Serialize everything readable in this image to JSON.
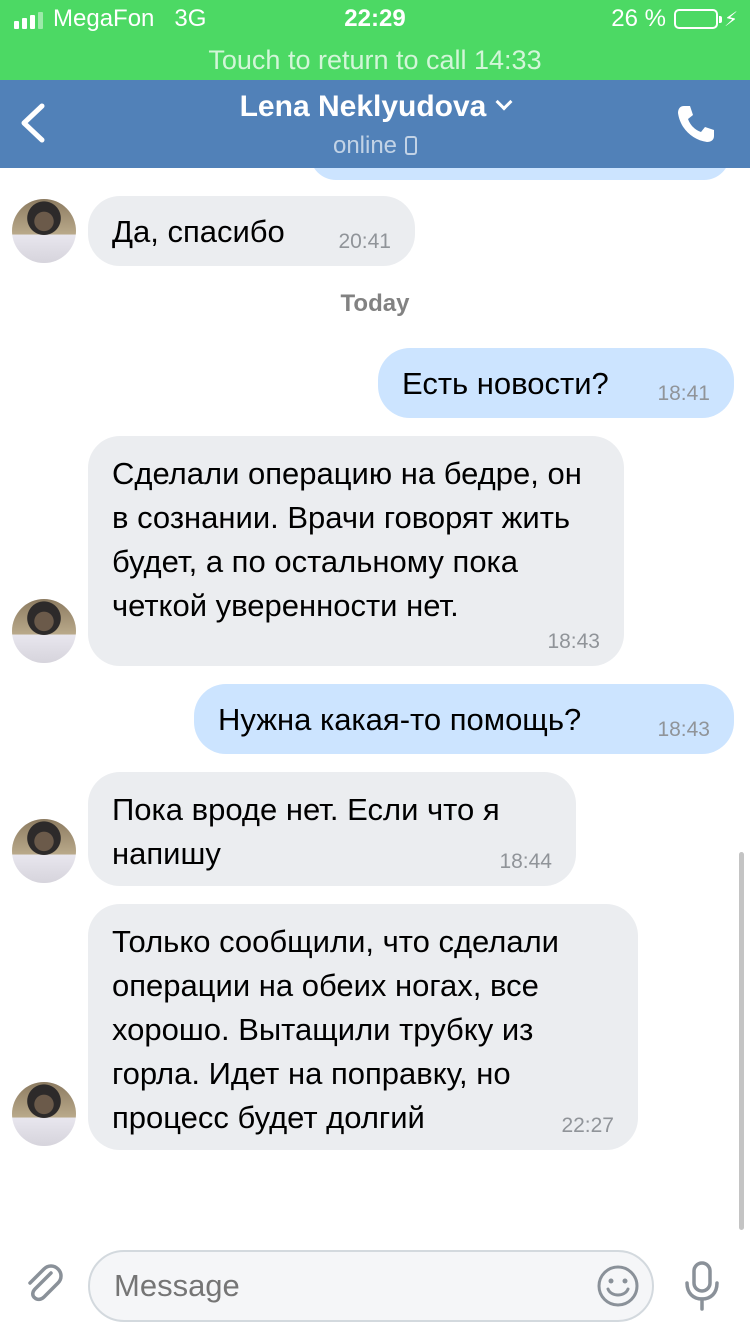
{
  "status_bar": {
    "carrier": "MegaFon",
    "network": "3G",
    "time": "22:29",
    "battery": "26 %",
    "battery_level": 0.26
  },
  "call_banner": "Touch to return to call 14:33",
  "header": {
    "title": "Lena Neklyudova",
    "status": "online"
  },
  "date_separator": "Today",
  "messages": [
    {
      "direction": "in",
      "text": "Да, спасибо",
      "time": "20:41"
    },
    {
      "direction": "out",
      "text": "Есть новости?",
      "time": "18:41"
    },
    {
      "direction": "in",
      "text": "Сделали операцию на бедре, он в сознании. Врачи говорят жить будет, а по остальному пока четкой уверенности нет.",
      "time": "18:43"
    },
    {
      "direction": "out",
      "text": "Нужна какая-то помощь?",
      "time": "18:43"
    },
    {
      "direction": "in",
      "text": "Пока вроде нет. Если что я напишу",
      "time": "18:44"
    },
    {
      "direction": "in",
      "text": "Только сообщили, что сделали операции на обеих ногах, все хорошо. Вытащили трубку из горла. Идет на поправку, но процесс будет долгий",
      "time": "22:27"
    }
  ],
  "composer": {
    "placeholder": "Message"
  },
  "colors": {
    "status_bar": "#4cd964",
    "header": "#5181b8",
    "incoming_bubble": "#ebedf0",
    "outgoing_bubble": "#cce4ff"
  }
}
